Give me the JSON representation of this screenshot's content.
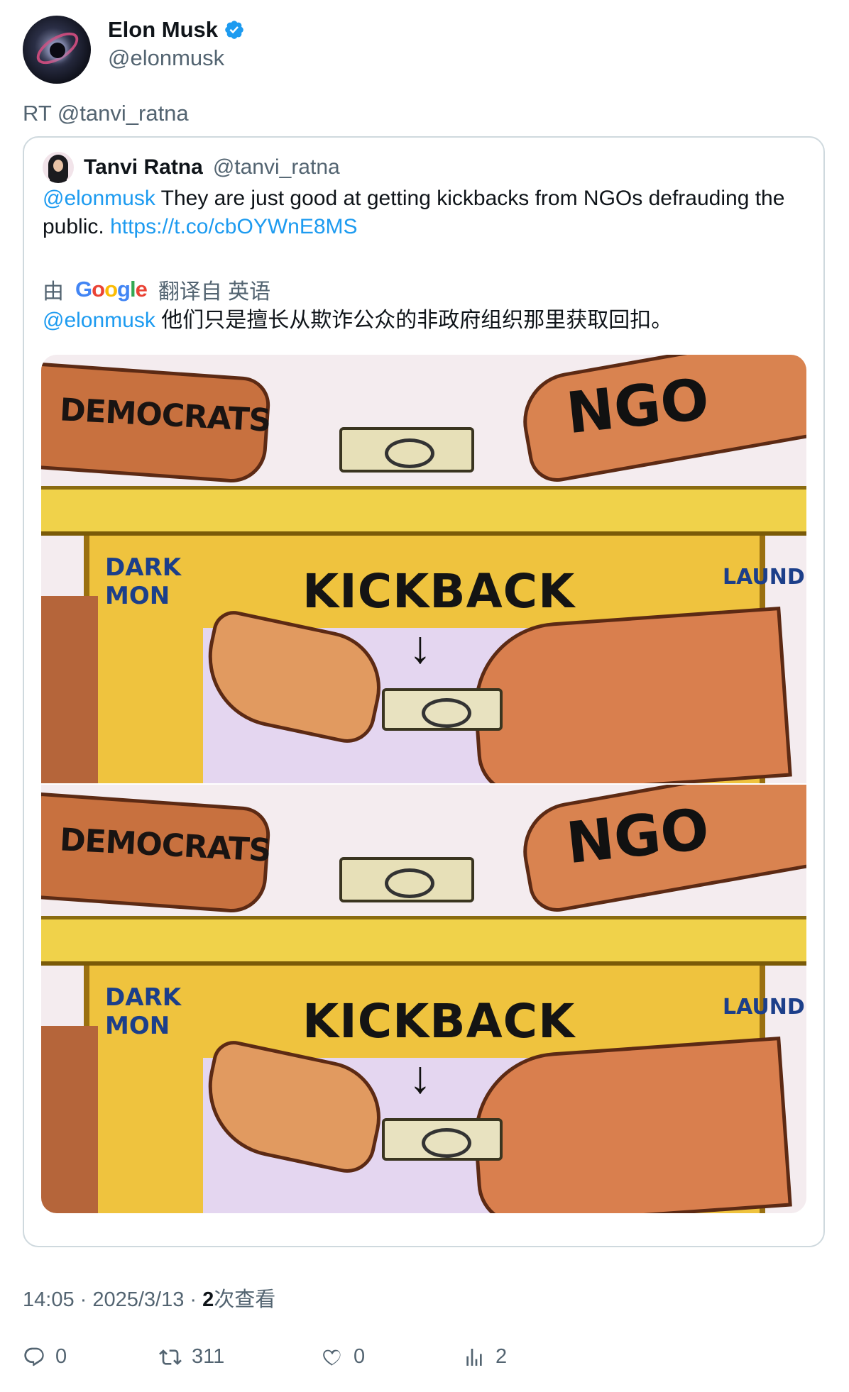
{
  "author": {
    "display_name": "Elon Musk",
    "handle": "@elonmusk",
    "verified": true,
    "avatar_icon": "galaxy-avatar"
  },
  "retweet_line": "RT @tanvi_ratna",
  "quoted_tweet": {
    "display_name": "Tanvi Ratna",
    "handle": "@tanvi_ratna",
    "mention": "@elonmusk",
    "text": " They are just good at getting kickbacks from NGOs defrauding the public. ",
    "link": "https://t.co/cbOYWnE8MS",
    "translation": {
      "prefix": "由",
      "provider_logo": "Google",
      "suffix": "翻译自 英语",
      "mention": "@elonmusk",
      "text": " 他们只是擅长从欺诈公众的非政府组织那里获取回扣。"
    },
    "media_labels": {
      "left_arm": "DEMOCRATS",
      "right_arm": "NGO",
      "table": "KICKBACK",
      "arrow": "↓",
      "left_side": "DARK\nMON",
      "right_side": "LAUNDERI"
    }
  },
  "meta": {
    "time": "14:05",
    "separator": " · ",
    "date": "2025/3/13",
    "views_count": "2",
    "views_label": "次查看"
  },
  "actions": {
    "replies": "0",
    "retweets": "311",
    "likes": "0",
    "views": "2"
  },
  "colors": {
    "link": "#1d9bf0",
    "verified": "#1d9bf0",
    "secondary_text": "#536471",
    "border": "#cfd9de"
  }
}
